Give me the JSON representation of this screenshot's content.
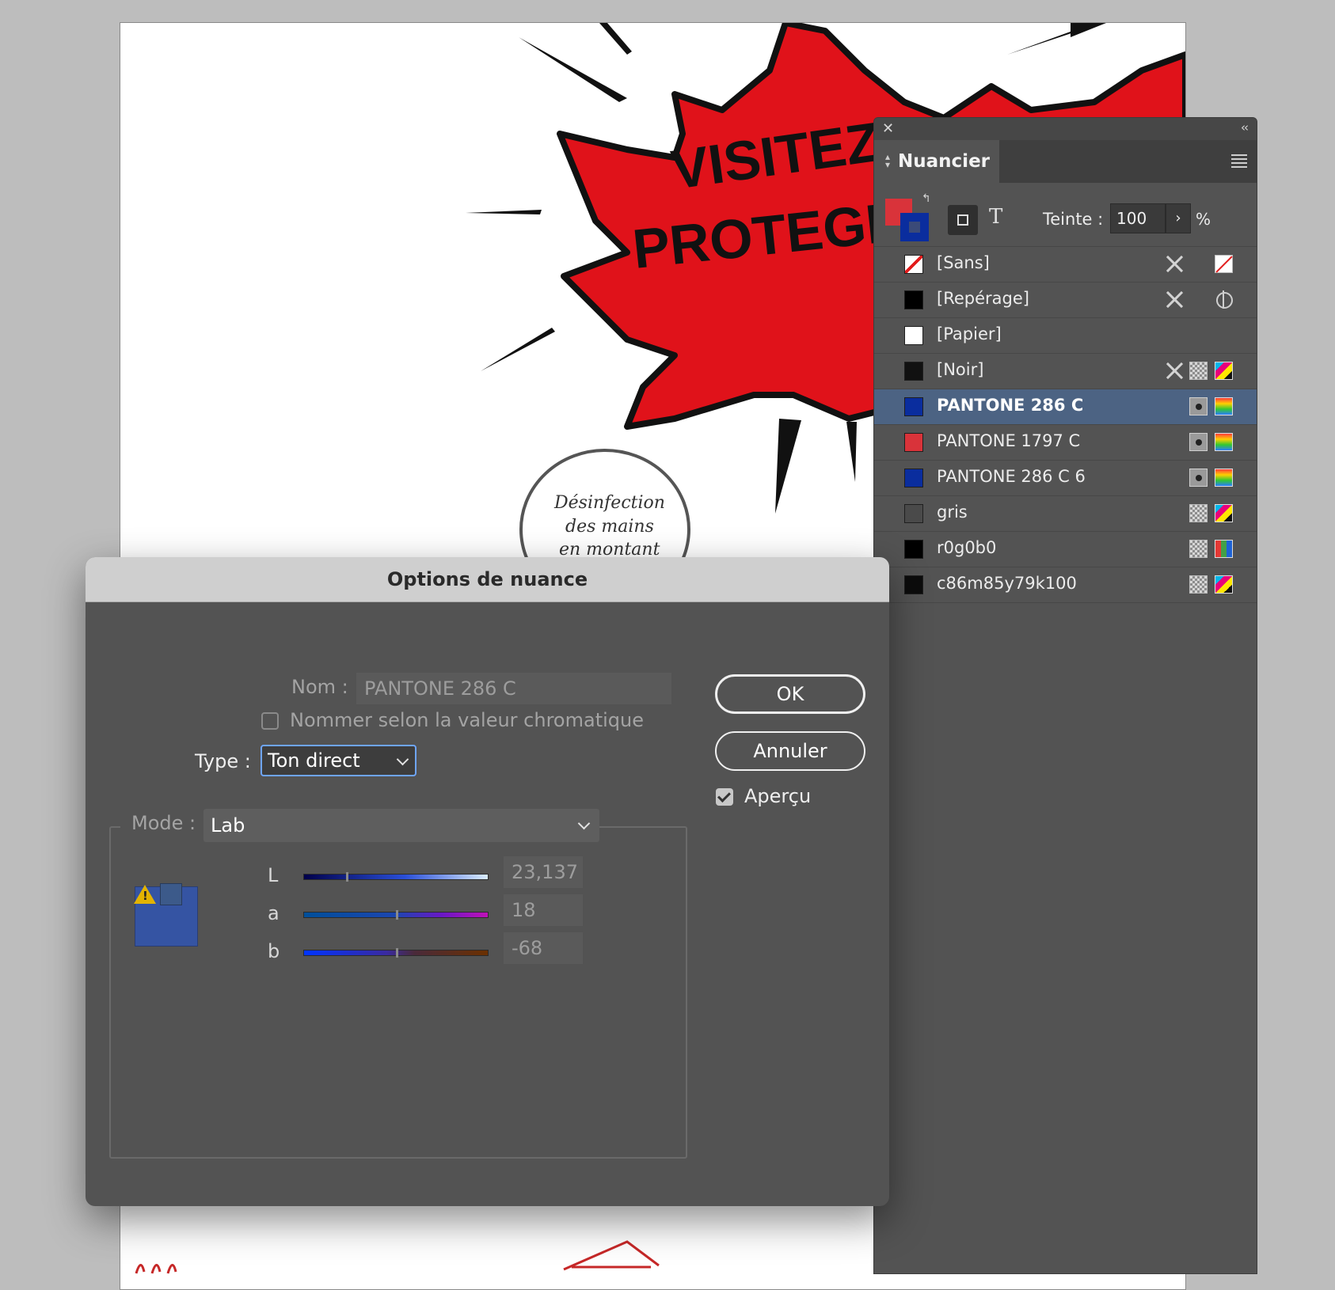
{
  "artboard": {
    "headline_line1": "VISITEZ-",
    "headline_line2": "PROTEGEZ",
    "bubble_line1": "Désinfection",
    "bubble_line2": "des mains",
    "bubble_line3": "en montant",
    "burst_color": "#e0121a"
  },
  "swatches_panel": {
    "title": "Nuancier",
    "tint_label": "Teinte :",
    "tint_value": "100",
    "tint_unit": "%",
    "fill_color": "#d9333a",
    "stroke_color": "#0a2d9e",
    "items": [
      {
        "name": "[Sans]",
        "color": "#ffffff",
        "icons": [
          "pencil-crossed-icon",
          "none-icon"
        ],
        "selected": false
      },
      {
        "name": "[Repérage]",
        "color": "#000000",
        "icons": [
          "pencil-crossed-icon",
          "registration-icon"
        ],
        "selected": false
      },
      {
        "name": "[Papier]",
        "color": "#ffffff",
        "icons": [],
        "selected": false
      },
      {
        "name": "[Noir]",
        "color": "#111111",
        "icons": [
          "pencil-crossed-icon",
          "process-icon",
          "cmyk-icon"
        ],
        "selected": false
      },
      {
        "name": "PANTONE 286 C",
        "color": "#0a2d9e",
        "icons": [
          "spot-icon",
          "lab-icon"
        ],
        "selected": true
      },
      {
        "name": "PANTONE 1797 C",
        "color": "#d9333a",
        "icons": [
          "spot-icon",
          "lab-icon"
        ],
        "selected": false
      },
      {
        "name": "PANTONE 286 C 6",
        "color": "#0a2d9e",
        "icons": [
          "spot-icon",
          "lab-icon"
        ],
        "selected": false
      },
      {
        "name": "gris",
        "color": "#4a4a4a",
        "icons": [
          "process-icon",
          "cmyk-icon"
        ],
        "selected": false
      },
      {
        "name": "r0g0b0",
        "color": "#000000",
        "icons": [
          "process-icon",
          "rgb-icon"
        ],
        "selected": false
      },
      {
        "name": "c86m85y79k100",
        "color": "#0c0c0c",
        "icons": [
          "process-icon",
          "cmyk-icon"
        ],
        "selected": false
      }
    ]
  },
  "dialog": {
    "title": "Options de nuance",
    "name_label": "Nom :",
    "name_value": "PANTONE 286 C",
    "name_by_value_label": "Nommer selon la valeur chromatique",
    "type_label": "Type :",
    "type_value": "Ton direct",
    "mode_label": "Mode :",
    "mode_value": "Lab",
    "ok_label": "OK",
    "cancel_label": "Annuler",
    "preview_label": "Aperçu",
    "preview_checked": true,
    "swatch_color": "#3554a3",
    "channels": [
      {
        "label": "L",
        "value": "23,137",
        "position": 0.23
      },
      {
        "label": "a",
        "value": "18",
        "position": 0.5
      },
      {
        "label": "b",
        "value": "-68",
        "position": 0.5
      }
    ]
  }
}
